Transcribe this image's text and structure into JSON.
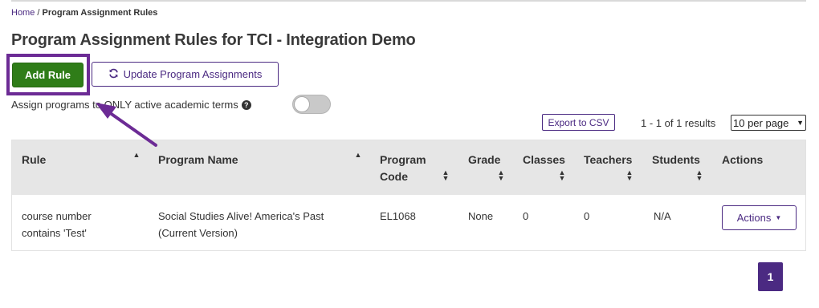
{
  "breadcrumb": {
    "home": "Home",
    "separator": " / ",
    "current": "Program Assignment Rules"
  },
  "page_title": "Program Assignment Rules for TCI - Integration Demo",
  "buttons": {
    "add_rule": "Add Rule",
    "update_assignments": "Update Program Assignments",
    "update_icon": "refresh-icon",
    "export_csv": "Export to CSV"
  },
  "assign_toggle": {
    "label": "Assign programs to ONLY active academic terms",
    "help_icon": "question-circle-icon",
    "enabled": false
  },
  "results": {
    "count_text": "1 - 1 of 1 results",
    "per_page": "10 per page",
    "per_page_options": [
      "10 per page"
    ]
  },
  "table": {
    "headers": {
      "rule": "Rule",
      "program_name": "Program Name",
      "program_code_1": "Program",
      "program_code_2": "Code",
      "grade": "Grade",
      "classes": "Classes",
      "teachers": "Teachers",
      "students": "Students",
      "actions": "Actions"
    },
    "rows": [
      {
        "rule_1": "course number",
        "rule_2": "contains 'Test'",
        "program_name_1": "Social Studies Alive! America's Past",
        "program_name_2": "(Current Version)",
        "program_code": "EL1068",
        "grade": "None",
        "classes": "0",
        "teachers": "0",
        "students": "N/A",
        "actions_label": "Actions"
      }
    ]
  },
  "pagination": {
    "current_page": "1"
  },
  "colors": {
    "brand_purple": "#4b2a82",
    "add_green": "#2f7d18",
    "annotation_purple": "#6c2b95",
    "header_gray": "#e6e6e6"
  }
}
